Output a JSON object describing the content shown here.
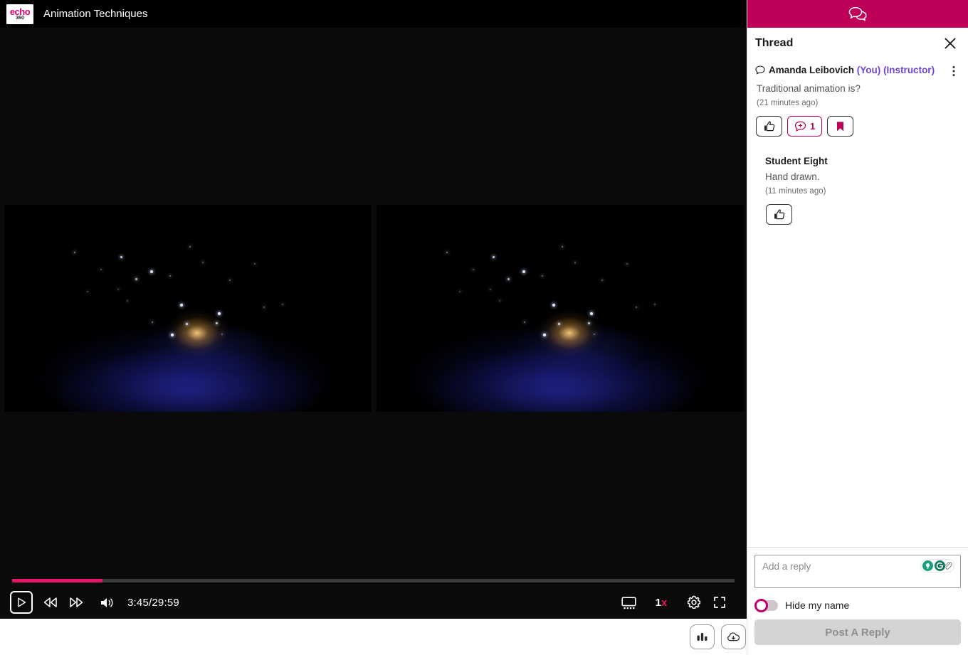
{
  "player": {
    "logo": {
      "line1": "echo",
      "line2": "360",
      "icon": "echo360-logo"
    },
    "title": "Animation Techniques",
    "timecode": "3:45/29:59",
    "current_time": "3:45",
    "duration": "29:59",
    "progress_percent": 12.5,
    "speed_label_number": "1",
    "speed_label_suffix": "x",
    "controls": {
      "play": "play-button",
      "rewind": "rewind-button",
      "forward": "fast-forward-button",
      "volume": "volume-button",
      "slides": "slides-view-button",
      "speed": "playback-speed-button",
      "settings": "settings-button",
      "fullscreen": "fullscreen-button"
    },
    "float_tools": [
      {
        "icon": "analytics-icon",
        "name": "analytics-button"
      },
      {
        "icon": "cloud-download-icon",
        "name": "download-button"
      }
    ]
  },
  "thread": {
    "tab_icon": "chat-bubbles-icon",
    "title": "Thread",
    "close_icon": "close-icon",
    "post": {
      "author": "Amanda Leibovich",
      "badge_you": "(You)",
      "badge_role": "(Instructor)",
      "text": "Traditional animation is?",
      "time": "(21 minutes ago)",
      "actions": [
        {
          "name": "like-button",
          "icon": "thumbs-up-icon",
          "count": ""
        },
        {
          "name": "reply-count-button",
          "icon": "add-comment-icon",
          "count": "1"
        },
        {
          "name": "bookmark-button",
          "icon": "bookmark-icon",
          "count": ""
        }
      ]
    },
    "reply": {
      "author": "Student Eight",
      "text": "Hand drawn.",
      "time": "(11 minutes ago)",
      "actions": [
        {
          "name": "like-reply-button",
          "icon": "thumbs-up-icon"
        }
      ]
    },
    "composer": {
      "placeholder": "Add a reply",
      "value": "",
      "tool_icons": [
        "lightbulb-icon",
        "grammarly-icon",
        "paperclip-icon"
      ],
      "hide_name_label": "Hide my name",
      "hide_name_on": false,
      "post_button_label": "Post A Reply"
    }
  },
  "colors": {
    "accent_magenta": "#be0058",
    "scrubber_pink": "#e8136b",
    "badge_purple": "#6f42d1",
    "player_black": "#0a0a0a",
    "logo_pink": "#d6006e"
  }
}
